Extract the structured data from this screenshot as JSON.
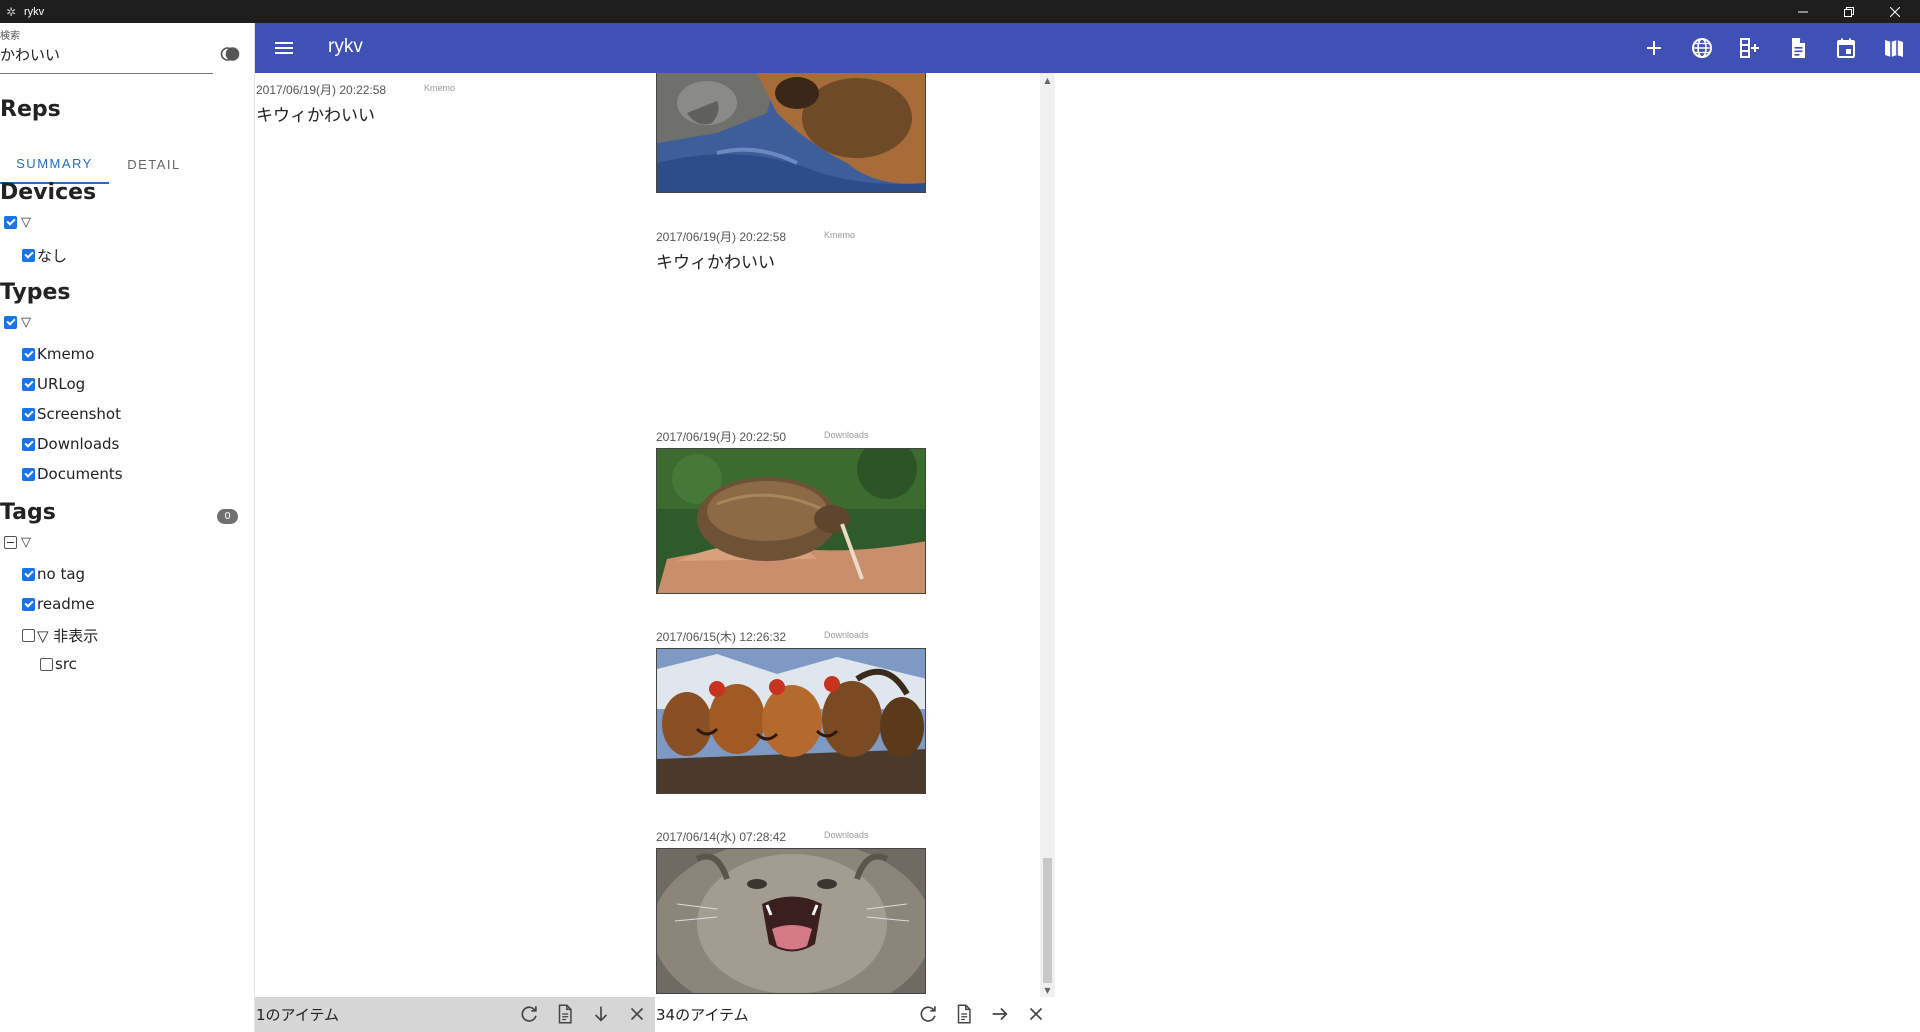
{
  "window": {
    "title": "rykv"
  },
  "sidebar": {
    "search_label": "検索",
    "search_value": "かわいい",
    "reps_heading": "Reps",
    "tabs": [
      "SUMMARY",
      "DETAIL"
    ],
    "devices_heading": "Devices",
    "devices_root": "▽",
    "devices": [
      "なし"
    ],
    "types_heading": "Types",
    "types_root": "▽",
    "types": [
      "Kmemo",
      "URLog",
      "Screenshot",
      "Downloads",
      "Documents"
    ],
    "tags_heading": "Tags",
    "tags_badge": "0",
    "tags_root": "▽",
    "tags": [
      "no tag",
      "readme",
      "▽ 非表示",
      "src"
    ]
  },
  "appbar": {
    "title": "rykv",
    "icons": [
      "add-icon",
      "globe-icon",
      "add-column-icon",
      "document-icon",
      "calendar-icon",
      "map-icon"
    ]
  },
  "column1": {
    "items": [
      {
        "timestamp": "2017/06/19(月) 20:22:58",
        "source": "Kmemo",
        "text": "キウィかわいい"
      }
    ],
    "footer": "1のアイテム"
  },
  "column2": {
    "items": [
      {
        "timestamp": "",
        "source": "",
        "image": "cat-dog-photo"
      },
      {
        "timestamp": "2017/06/19(月) 20:22:58",
        "source": "Kmemo",
        "text": "キウィかわいい"
      },
      {
        "timestamp": "2017/06/19(月) 20:22:50",
        "source": "Downloads",
        "image": "kiwi-bird-photo"
      },
      {
        "timestamp": "2017/06/15(木) 12:26:32",
        "source": "Downloads",
        "image": "roosters-photo"
      },
      {
        "timestamp": "2017/06/14(水) 07:28:42",
        "source": "Downloads",
        "image": "yawning-cat-photo"
      }
    ],
    "footer": "34のアイテム"
  },
  "colors": {
    "appbar": "#3f51b5",
    "tab_active": "#1f6fc5",
    "checkbox": "#1a73e8"
  }
}
